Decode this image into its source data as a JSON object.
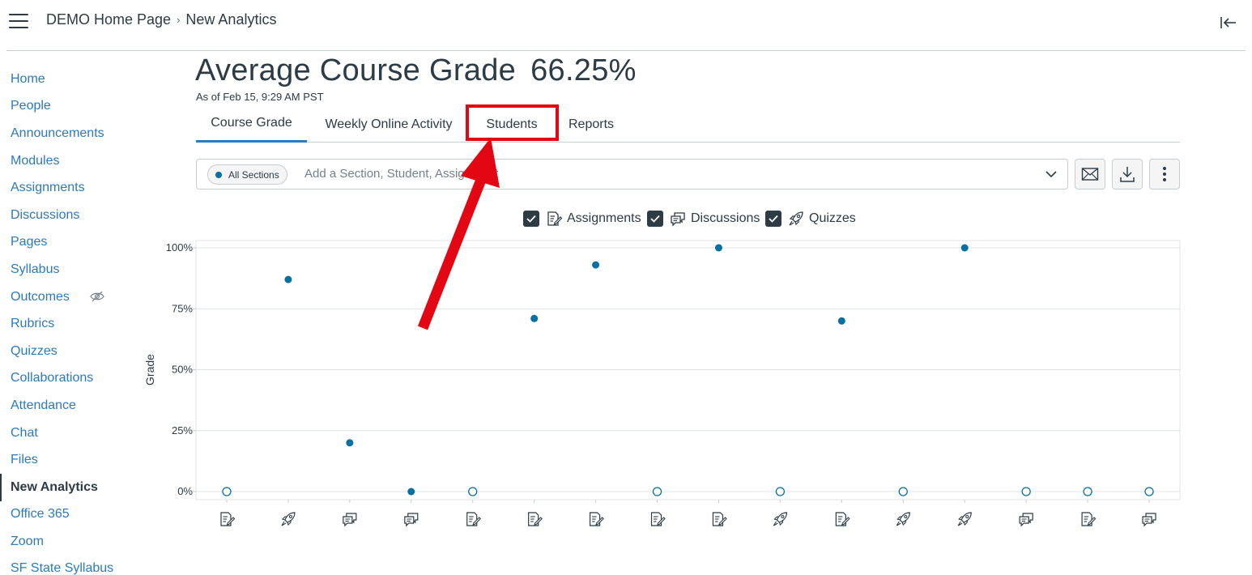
{
  "breadcrumb": {
    "home": "DEMO Home Page",
    "separator": "›",
    "current": "New Analytics"
  },
  "nav": [
    {
      "label": "Home"
    },
    {
      "label": "People"
    },
    {
      "label": "Announcements"
    },
    {
      "label": "Modules"
    },
    {
      "label": "Assignments"
    },
    {
      "label": "Discussions"
    },
    {
      "label": "Pages"
    },
    {
      "label": "Syllabus"
    },
    {
      "label": "Outcomes",
      "hidden_icon": "eye-slash-icon"
    },
    {
      "label": "Rubrics"
    },
    {
      "label": "Quizzes"
    },
    {
      "label": "Collaborations"
    },
    {
      "label": "Attendance"
    },
    {
      "label": "Chat"
    },
    {
      "label": "Files"
    },
    {
      "label": "New Analytics",
      "active": true
    },
    {
      "label": "Office 365"
    },
    {
      "label": "Zoom"
    },
    {
      "label": "SF State Syllabus"
    }
  ],
  "page": {
    "title": "Average Course Grade",
    "grade": "66.25%",
    "as_of": "As of Feb 15, 9:29 AM PST"
  },
  "tabs": [
    {
      "label": "Course Grade",
      "active": true
    },
    {
      "label": "Weekly Online Activity"
    },
    {
      "label": "Students",
      "highlighted": true
    },
    {
      "label": "Reports"
    }
  ],
  "filter": {
    "pill": "All Sections",
    "placeholder": "Add a Section, Student, Assignment"
  },
  "toolbar": {
    "message_icon": "envelope-icon",
    "download_icon": "download-icon",
    "more_icon": "kebab-menu-icon"
  },
  "legend": [
    {
      "label": "Assignments",
      "icon": "assignment-icon",
      "checked": true
    },
    {
      "label": "Discussions",
      "icon": "discussion-icon",
      "checked": true
    },
    {
      "label": "Quizzes",
      "icon": "quiz-icon",
      "checked": true
    }
  ],
  "colors": {
    "accent": "#0770a3",
    "link": "#2b7abc",
    "text": "#2d3b45",
    "annotation": "#e30613"
  },
  "chart_data": {
    "type": "scatter",
    "ylabel": "Grade",
    "ylim": [
      0,
      100
    ],
    "yticks": [
      "0%",
      "25%",
      "50%",
      "75%",
      "100%"
    ],
    "grid": true,
    "points": [
      {
        "kind": "assignment",
        "value": 0,
        "graded": false
      },
      {
        "kind": "quiz",
        "value": 87,
        "graded": true
      },
      {
        "kind": "discussion",
        "value": 20,
        "graded": true
      },
      {
        "kind": "discussion",
        "value": 0,
        "graded": true
      },
      {
        "kind": "assignment",
        "value": 0,
        "graded": false
      },
      {
        "kind": "assignment",
        "value": 71,
        "graded": true
      },
      {
        "kind": "assignment",
        "value": 93,
        "graded": true
      },
      {
        "kind": "assignment",
        "value": 0,
        "graded": false
      },
      {
        "kind": "assignment",
        "value": 100,
        "graded": true
      },
      {
        "kind": "quiz",
        "value": 0,
        "graded": false
      },
      {
        "kind": "assignment",
        "value": 70,
        "graded": true
      },
      {
        "kind": "quiz",
        "value": 0,
        "graded": false
      },
      {
        "kind": "quiz",
        "value": 100,
        "graded": true
      },
      {
        "kind": "discussion",
        "value": 0,
        "graded": false
      },
      {
        "kind": "assignment",
        "value": 0,
        "graded": false
      },
      {
        "kind": "discussion",
        "value": 0,
        "graded": false
      }
    ]
  }
}
